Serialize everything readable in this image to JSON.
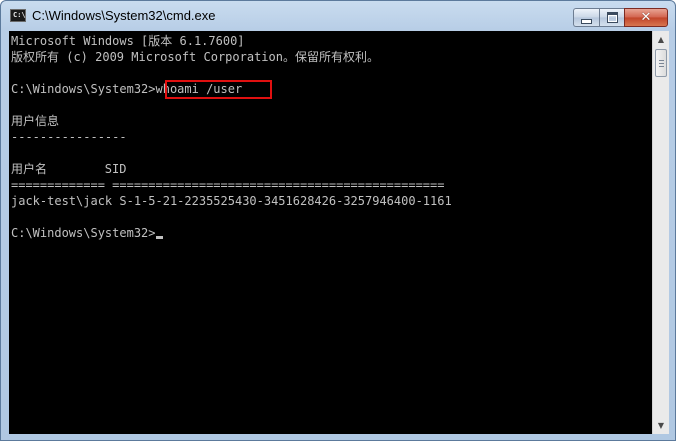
{
  "window": {
    "title": "C:\\Windows\\System32\\cmd.exe",
    "icon": "cmd-icon",
    "icon_glyph": "C:\\",
    "buttons": {
      "minimize": "minimize-icon",
      "maximize": "maximize-icon",
      "close": "close-icon",
      "close_glyph": "✕"
    }
  },
  "console": {
    "lines": [
      "Microsoft Windows [版本 6.1.7600]",
      "版权所有 (c) 2009 Microsoft Corporation。保留所有权利。",
      "",
      "C:\\Windows\\System32>whoami /user",
      "",
      "用户信息",
      "----------------",
      "",
      "用户名        SID",
      "============= ==============================================",
      "jack-test\\jack S-1-5-21-2235525430-3451628426-3257946400-1161",
      "",
      "C:\\Windows\\System32>"
    ],
    "highlighted_command": "whoami /user",
    "colors": {
      "background": "#000000",
      "text": "#c0c0c0",
      "highlight_border": "#e01010"
    }
  }
}
